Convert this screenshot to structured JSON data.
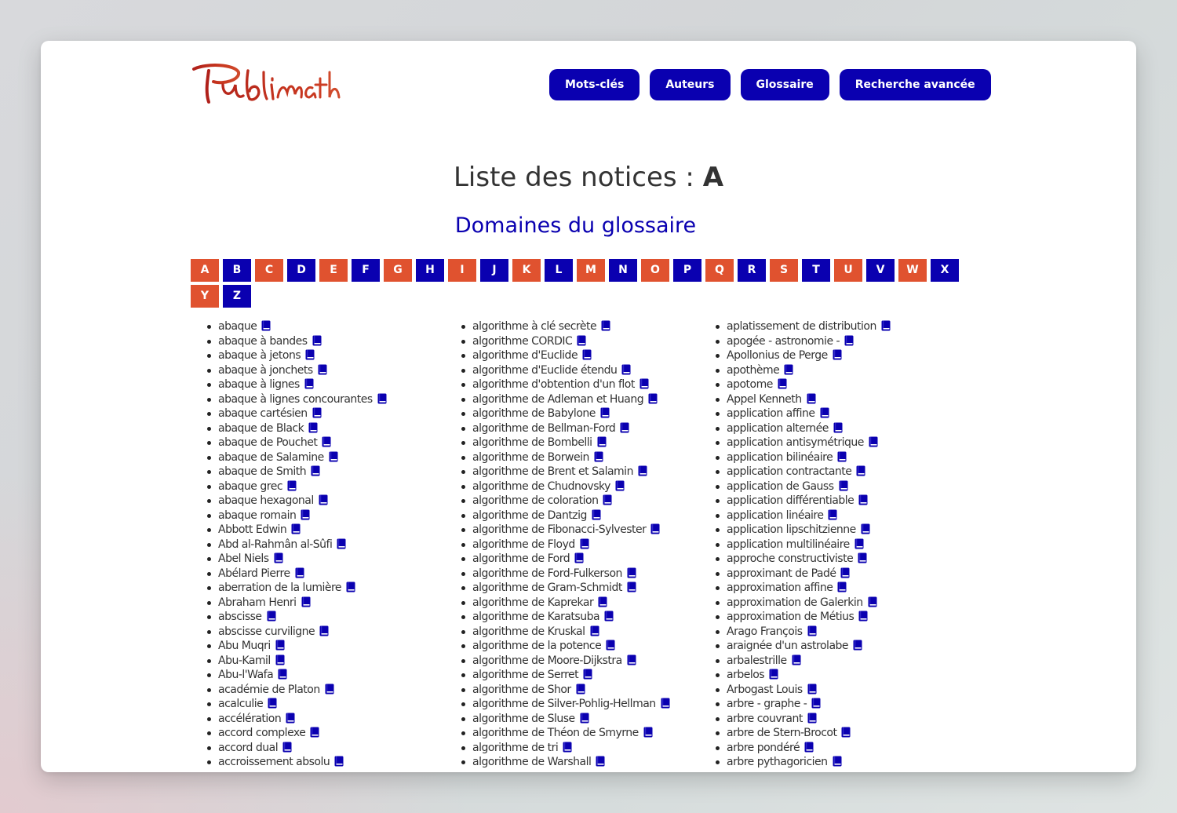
{
  "header": {
    "logo_text": "Publimath",
    "nav": [
      "Mots-clés",
      "Auteurs",
      "Glossaire",
      "Recherche avancée"
    ]
  },
  "title": {
    "prefix": "Liste des notices : ",
    "letter": "A"
  },
  "domains_link": "Domaines du glossaire",
  "letters": [
    {
      "l": "A",
      "c": "red"
    },
    {
      "l": "B",
      "c": "blue"
    },
    {
      "l": "C",
      "c": "red"
    },
    {
      "l": "D",
      "c": "blue"
    },
    {
      "l": "E",
      "c": "red"
    },
    {
      "l": "F",
      "c": "blue"
    },
    {
      "l": "G",
      "c": "red"
    },
    {
      "l": "H",
      "c": "blue"
    },
    {
      "l": "I",
      "c": "red"
    },
    {
      "l": "J",
      "c": "blue"
    },
    {
      "l": "K",
      "c": "red"
    },
    {
      "l": "L",
      "c": "blue"
    },
    {
      "l": "M",
      "c": "red"
    },
    {
      "l": "N",
      "c": "blue"
    },
    {
      "l": "O",
      "c": "red"
    },
    {
      "l": "P",
      "c": "blue"
    },
    {
      "l": "Q",
      "c": "red"
    },
    {
      "l": "R",
      "c": "blue"
    },
    {
      "l": "S",
      "c": "red"
    },
    {
      "l": "T",
      "c": "blue"
    },
    {
      "l": "U",
      "c": "red"
    },
    {
      "l": "V",
      "c": "blue"
    },
    {
      "l": "W",
      "c": "red"
    },
    {
      "l": "X",
      "c": "blue"
    },
    {
      "l": "Y",
      "c": "red"
    },
    {
      "l": "Z",
      "c": "blue"
    }
  ],
  "colors": {
    "red": "#e0522f",
    "blue": "#0a00b0"
  },
  "columns": [
    [
      "abaque",
      "abaque à bandes",
      "abaque à jetons",
      "abaque à jonchets",
      "abaque à lignes",
      "abaque à lignes concourantes",
      "abaque cartésien",
      "abaque de Black",
      "abaque de Pouchet",
      "abaque de Salamine",
      "abaque de Smith",
      "abaque grec",
      "abaque hexagonal",
      "abaque romain",
      "Abbott Edwin",
      "Abd al-Rahmân al-Sûfi",
      "Abel Niels",
      "Abélard Pierre",
      "aberration de la lumière",
      "Abraham Henri",
      "abscisse",
      "abscisse curviligne",
      "Abu Muqri",
      "Abu-Kamil",
      "Abu-l'Wafa",
      "académie de Platon",
      "acalculie",
      "accélération",
      "accord complexe",
      "accord dual",
      "accroissement absolu"
    ],
    [
      "algorithme à clé secrète",
      "algorithme CORDIC",
      "algorithme d'Euclide",
      "algorithme d'Euclide étendu",
      "algorithme d'obtention d'un flot",
      "algorithme de Adleman et Huang",
      "algorithme de Babylone",
      "algorithme de Bellman-Ford",
      "algorithme de Bombelli",
      "algorithme de Borwein",
      "algorithme de Brent et Salamin",
      "algorithme de Chudnovsky",
      "algorithme de coloration",
      "algorithme de Dantzig",
      "algorithme de Fibonacci-Sylvester",
      "algorithme de Floyd",
      "algorithme de Ford",
      "algorithme de Ford-Fulkerson",
      "algorithme de Gram-Schmidt",
      "algorithme de Kaprekar",
      "algorithme de Karatsuba",
      "algorithme de Kruskal",
      "algorithme de la potence",
      "algorithme de Moore-Dijkstra",
      "algorithme de Serret",
      "algorithme de Shor",
      "algorithme de Silver-Pohlig-Hellman",
      "algorithme de Sluse",
      "algorithme de Théon de Smyrne",
      "algorithme de tri",
      "algorithme de Warshall"
    ],
    [
      "aplatissement de distribution",
      "apogée - astronomie -",
      "Apollonius de Perge",
      "apothème",
      "apotome",
      "Appel Kenneth",
      "application affine",
      "application alternée",
      "application antisymétrique",
      "application bilinéaire",
      "application contractante",
      "application de Gauss",
      "application différentiable",
      "application linéaire",
      "application lipschitzienne",
      "application multilinéaire",
      "approche constructiviste",
      "approximant de Padé",
      "approximation affine",
      "approximation de Galerkin",
      "approximation de Métius",
      "Arago François",
      "araignée d'un astrolabe",
      "arbalestrille",
      "arbelos",
      "Arbogast Louis",
      "arbre - graphe -",
      "arbre couvrant",
      "arbre de Stern-Brocot",
      "arbre pondéré",
      "arbre pythagoricien"
    ]
  ]
}
